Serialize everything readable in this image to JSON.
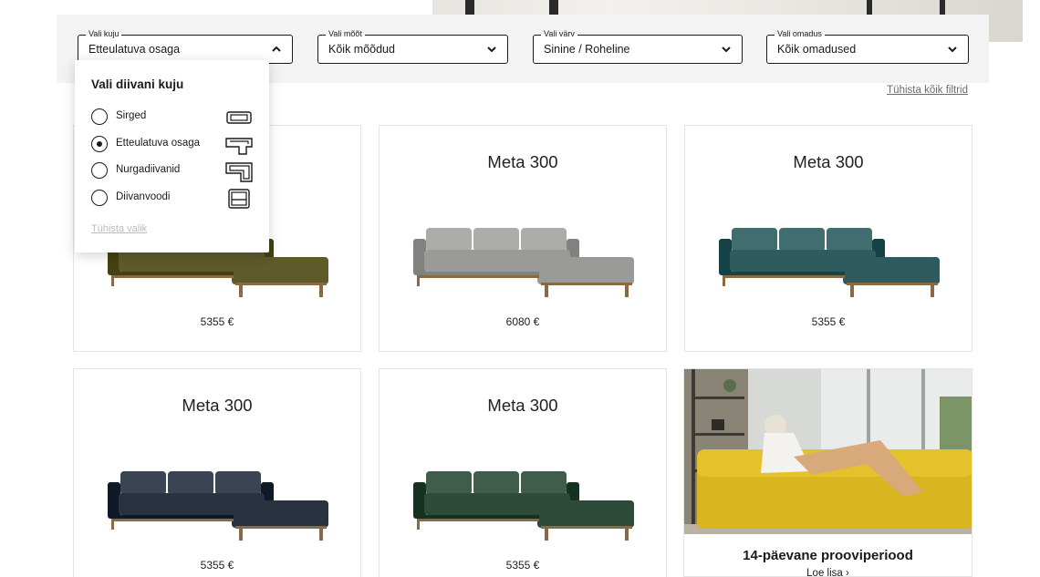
{
  "filters": {
    "shape": {
      "legend": "Vali kuju",
      "value": "Etteulatuva osaga",
      "icon": "chevron-up-icon"
    },
    "size": {
      "legend": "Vali mõõt",
      "value": "Kõik mõõdud",
      "icon": "chevron-down-icon"
    },
    "color": {
      "legend": "Vali värv",
      "value": "Sinine / Roheline",
      "icon": "chevron-down-icon"
    },
    "feature": {
      "legend": "Vali omadus",
      "value": "Kõik omadused",
      "icon": "chevron-down-icon"
    },
    "clear_all": "Tühista kõik filtrid"
  },
  "shape_dropdown": {
    "title": "Vali diivani kuju",
    "options": [
      {
        "label": "Sirged",
        "selected": false,
        "icon": "straight-sofa-icon"
      },
      {
        "label": "Etteulatuva osaga",
        "selected": true,
        "icon": "chaise-sofa-icon"
      },
      {
        "label": "Nurgadiivanid",
        "selected": false,
        "icon": "corner-sofa-icon"
      },
      {
        "label": "Diivanvoodi",
        "selected": false,
        "icon": "sofa-bed-icon"
      }
    ],
    "reset": "Tühista valik"
  },
  "products": [
    {
      "name": "",
      "price": "5355 €",
      "color": "#5e5a2a"
    },
    {
      "name": "Meta 300",
      "price": "6080 €",
      "color": "#9a9a98"
    },
    {
      "name": "Meta 300",
      "price": "5355 €",
      "color": "#2d5b5e"
    },
    {
      "name": "Meta 300",
      "price": "5355 €",
      "color": "#283240"
    },
    {
      "name": "Meta 300",
      "price": "5355 €",
      "color": "#2e4a38"
    }
  ],
  "promo": {
    "title": "14-päevane prooviperiood",
    "link": "Loe lisa ›",
    "sofa_color": "#d9b520"
  }
}
